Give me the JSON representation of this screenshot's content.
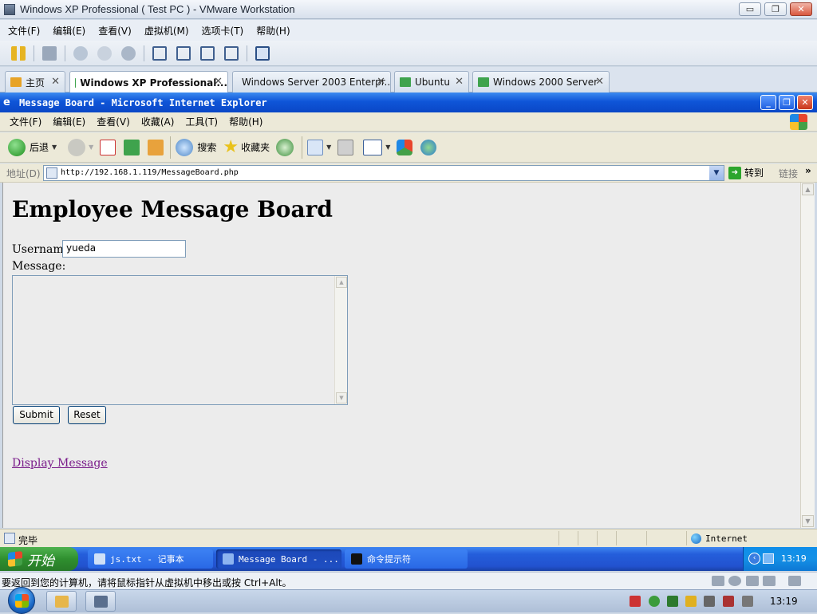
{
  "vmware": {
    "window_title": "Windows XP Professional ( Test PC ) - VMware Workstation",
    "window_controls": {
      "minimize": "▭",
      "restore": "❐",
      "close": "✕"
    },
    "menu": [
      "文件(F)",
      "编辑(E)",
      "查看(V)",
      "虚拟机(M)",
      "选项卡(T)",
      "帮助(H)"
    ],
    "tabs": [
      {
        "label": "主页",
        "close": "✕"
      },
      {
        "label": "Windows XP Professional...",
        "close": "✕"
      },
      {
        "label": "Windows Server 2003 Enterpr...",
        "close": "✕"
      },
      {
        "label": "Ubuntu",
        "close": "✕"
      },
      {
        "label": "Windows 2000 Server",
        "close": "✕"
      }
    ],
    "hint": "要返回到您的计算机，请将鼠标指针从虚拟机中移出或按 Ctrl+Alt。"
  },
  "ie": {
    "window_title": "Message Board - Microsoft Internet Explorer",
    "title_icon": "e",
    "window_controls": {
      "minimize": "_",
      "restore": "❐",
      "close": "✕"
    },
    "menu": [
      "文件(F)",
      "编辑(E)",
      "查看(V)",
      "收藏(A)",
      "工具(T)",
      "帮助(H)"
    ],
    "toolbar": {
      "back": "后退",
      "search": "搜索",
      "favorites": "收藏夹",
      "dropdown": "▼"
    },
    "address": {
      "label": "地址(D)",
      "url": "http://192.168.1.119/MessageBoard.php",
      "dropdown": "▼",
      "go": "转到",
      "go_icon": "➜",
      "links": "链接",
      "more": "»"
    },
    "scroll": {
      "up": "▲",
      "down": "▼"
    },
    "status": {
      "text": "完毕",
      "zone": "Internet"
    }
  },
  "page": {
    "heading": "Employee Message Board",
    "username_label": "Username:",
    "username_value": "yueda",
    "message_label": "Message:",
    "submit": "Submit",
    "reset": "Reset",
    "display_link": "Display Message"
  },
  "xp_taskbar": {
    "start": "开始",
    "tasks": [
      "js.txt - 记事本",
      "Message Board - ...",
      "命令提示符"
    ],
    "tray_arrow": "‹",
    "clock": "13:19"
  },
  "host_taskbar": {
    "clock": "13:19"
  },
  "colors": {
    "xp_blue": "#245edb",
    "xp_start_green": "#3c9c3c",
    "link_visited": "#7a1c8a"
  }
}
